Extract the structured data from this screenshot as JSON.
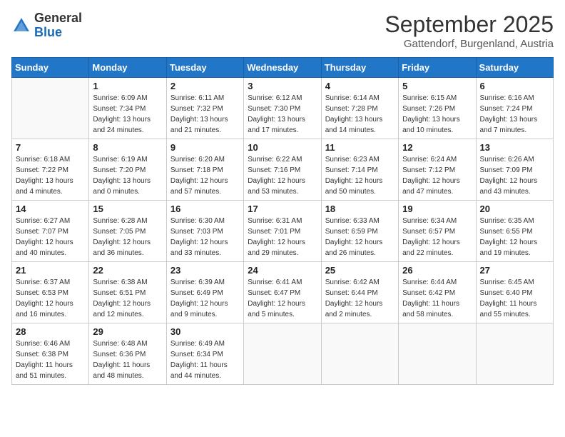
{
  "header": {
    "logo": {
      "general": "General",
      "blue": "Blue"
    },
    "title": "September 2025",
    "subtitle": "Gattendorf, Burgenland, Austria"
  },
  "calendar": {
    "weekdays": [
      "Sunday",
      "Monday",
      "Tuesday",
      "Wednesday",
      "Thursday",
      "Friday",
      "Saturday"
    ],
    "weeks": [
      [
        {
          "day": "",
          "info": ""
        },
        {
          "day": "1",
          "info": "Sunrise: 6:09 AM\nSunset: 7:34 PM\nDaylight: 13 hours\nand 24 minutes."
        },
        {
          "day": "2",
          "info": "Sunrise: 6:11 AM\nSunset: 7:32 PM\nDaylight: 13 hours\nand 21 minutes."
        },
        {
          "day": "3",
          "info": "Sunrise: 6:12 AM\nSunset: 7:30 PM\nDaylight: 13 hours\nand 17 minutes."
        },
        {
          "day": "4",
          "info": "Sunrise: 6:14 AM\nSunset: 7:28 PM\nDaylight: 13 hours\nand 14 minutes."
        },
        {
          "day": "5",
          "info": "Sunrise: 6:15 AM\nSunset: 7:26 PM\nDaylight: 13 hours\nand 10 minutes."
        },
        {
          "day": "6",
          "info": "Sunrise: 6:16 AM\nSunset: 7:24 PM\nDaylight: 13 hours\nand 7 minutes."
        }
      ],
      [
        {
          "day": "7",
          "info": "Sunrise: 6:18 AM\nSunset: 7:22 PM\nDaylight: 13 hours\nand 4 minutes."
        },
        {
          "day": "8",
          "info": "Sunrise: 6:19 AM\nSunset: 7:20 PM\nDaylight: 13 hours\nand 0 minutes."
        },
        {
          "day": "9",
          "info": "Sunrise: 6:20 AM\nSunset: 7:18 PM\nDaylight: 12 hours\nand 57 minutes."
        },
        {
          "day": "10",
          "info": "Sunrise: 6:22 AM\nSunset: 7:16 PM\nDaylight: 12 hours\nand 53 minutes."
        },
        {
          "day": "11",
          "info": "Sunrise: 6:23 AM\nSunset: 7:14 PM\nDaylight: 12 hours\nand 50 minutes."
        },
        {
          "day": "12",
          "info": "Sunrise: 6:24 AM\nSunset: 7:12 PM\nDaylight: 12 hours\nand 47 minutes."
        },
        {
          "day": "13",
          "info": "Sunrise: 6:26 AM\nSunset: 7:09 PM\nDaylight: 12 hours\nand 43 minutes."
        }
      ],
      [
        {
          "day": "14",
          "info": "Sunrise: 6:27 AM\nSunset: 7:07 PM\nDaylight: 12 hours\nand 40 minutes."
        },
        {
          "day": "15",
          "info": "Sunrise: 6:28 AM\nSunset: 7:05 PM\nDaylight: 12 hours\nand 36 minutes."
        },
        {
          "day": "16",
          "info": "Sunrise: 6:30 AM\nSunset: 7:03 PM\nDaylight: 12 hours\nand 33 minutes."
        },
        {
          "day": "17",
          "info": "Sunrise: 6:31 AM\nSunset: 7:01 PM\nDaylight: 12 hours\nand 29 minutes."
        },
        {
          "day": "18",
          "info": "Sunrise: 6:33 AM\nSunset: 6:59 PM\nDaylight: 12 hours\nand 26 minutes."
        },
        {
          "day": "19",
          "info": "Sunrise: 6:34 AM\nSunset: 6:57 PM\nDaylight: 12 hours\nand 22 minutes."
        },
        {
          "day": "20",
          "info": "Sunrise: 6:35 AM\nSunset: 6:55 PM\nDaylight: 12 hours\nand 19 minutes."
        }
      ],
      [
        {
          "day": "21",
          "info": "Sunrise: 6:37 AM\nSunset: 6:53 PM\nDaylight: 12 hours\nand 16 minutes."
        },
        {
          "day": "22",
          "info": "Sunrise: 6:38 AM\nSunset: 6:51 PM\nDaylight: 12 hours\nand 12 minutes."
        },
        {
          "day": "23",
          "info": "Sunrise: 6:39 AM\nSunset: 6:49 PM\nDaylight: 12 hours\nand 9 minutes."
        },
        {
          "day": "24",
          "info": "Sunrise: 6:41 AM\nSunset: 6:47 PM\nDaylight: 12 hours\nand 5 minutes."
        },
        {
          "day": "25",
          "info": "Sunrise: 6:42 AM\nSunset: 6:44 PM\nDaylight: 12 hours\nand 2 minutes."
        },
        {
          "day": "26",
          "info": "Sunrise: 6:44 AM\nSunset: 6:42 PM\nDaylight: 11 hours\nand 58 minutes."
        },
        {
          "day": "27",
          "info": "Sunrise: 6:45 AM\nSunset: 6:40 PM\nDaylight: 11 hours\nand 55 minutes."
        }
      ],
      [
        {
          "day": "28",
          "info": "Sunrise: 6:46 AM\nSunset: 6:38 PM\nDaylight: 11 hours\nand 51 minutes."
        },
        {
          "day": "29",
          "info": "Sunrise: 6:48 AM\nSunset: 6:36 PM\nDaylight: 11 hours\nand 48 minutes."
        },
        {
          "day": "30",
          "info": "Sunrise: 6:49 AM\nSunset: 6:34 PM\nDaylight: 11 hours\nand 44 minutes."
        },
        {
          "day": "",
          "info": ""
        },
        {
          "day": "",
          "info": ""
        },
        {
          "day": "",
          "info": ""
        },
        {
          "day": "",
          "info": ""
        }
      ]
    ]
  }
}
